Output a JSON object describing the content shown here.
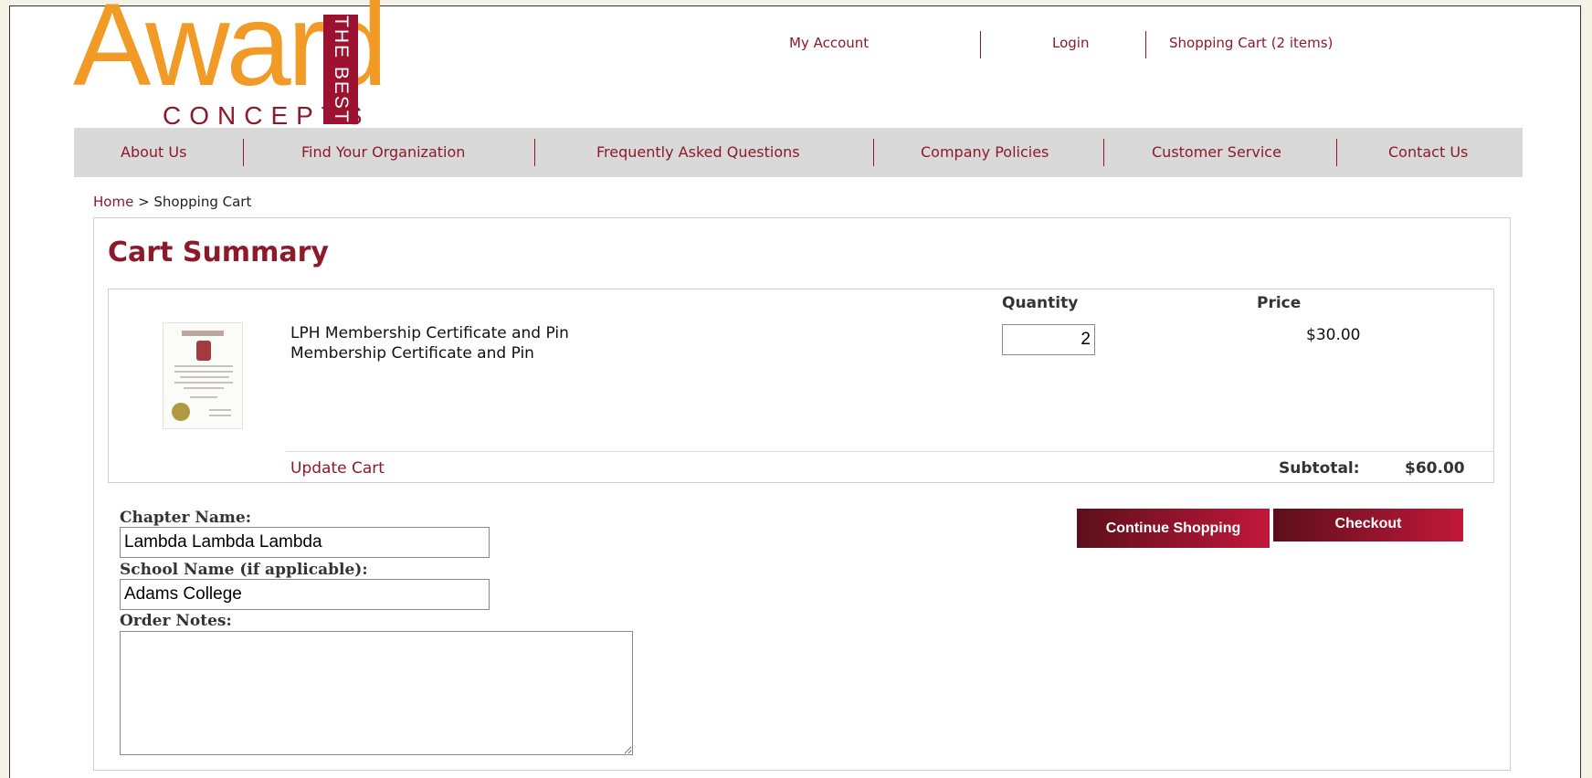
{
  "logo": {
    "word": "Award",
    "sub": "CONCEPTS",
    "badge": "THE BEST"
  },
  "top_links": {
    "my_account": "My Account",
    "login": "Login",
    "cart": "Shopping Cart (2 items)"
  },
  "nav": {
    "items": [
      "About Us",
      "Find Your Organization",
      "Frequently Asked Questions",
      "Company Policies",
      "Customer Service",
      "Contact Us"
    ]
  },
  "breadcrumb": {
    "home": "Home",
    "separator": " > ",
    "current": "Shopping Cart"
  },
  "cart": {
    "title": "Cart Summary",
    "quantity_header": "Quantity",
    "price_header": "Price",
    "item": {
      "name": "LPH Membership Certificate and Pin",
      "description": "Membership Certificate and Pin",
      "quantity": "2",
      "price": "$30.00"
    },
    "update_label": "Update Cart",
    "subtotal_label": "Subtotal:",
    "subtotal_value": "$60.00"
  },
  "form": {
    "chapter_label": "Chapter Name:",
    "chapter_value": "Lambda Lambda Lambda",
    "school_label": "School Name (if applicable):",
    "school_value": "Adams College",
    "notes_label": "Order Notes:",
    "notes_value": ""
  },
  "buttons": {
    "continue": "Continue Shopping",
    "checkout": "Checkout"
  },
  "colors": {
    "accent": "#8c1a2b",
    "logo_orange": "#f29a26",
    "nav_bg": "#d9d9d9"
  }
}
